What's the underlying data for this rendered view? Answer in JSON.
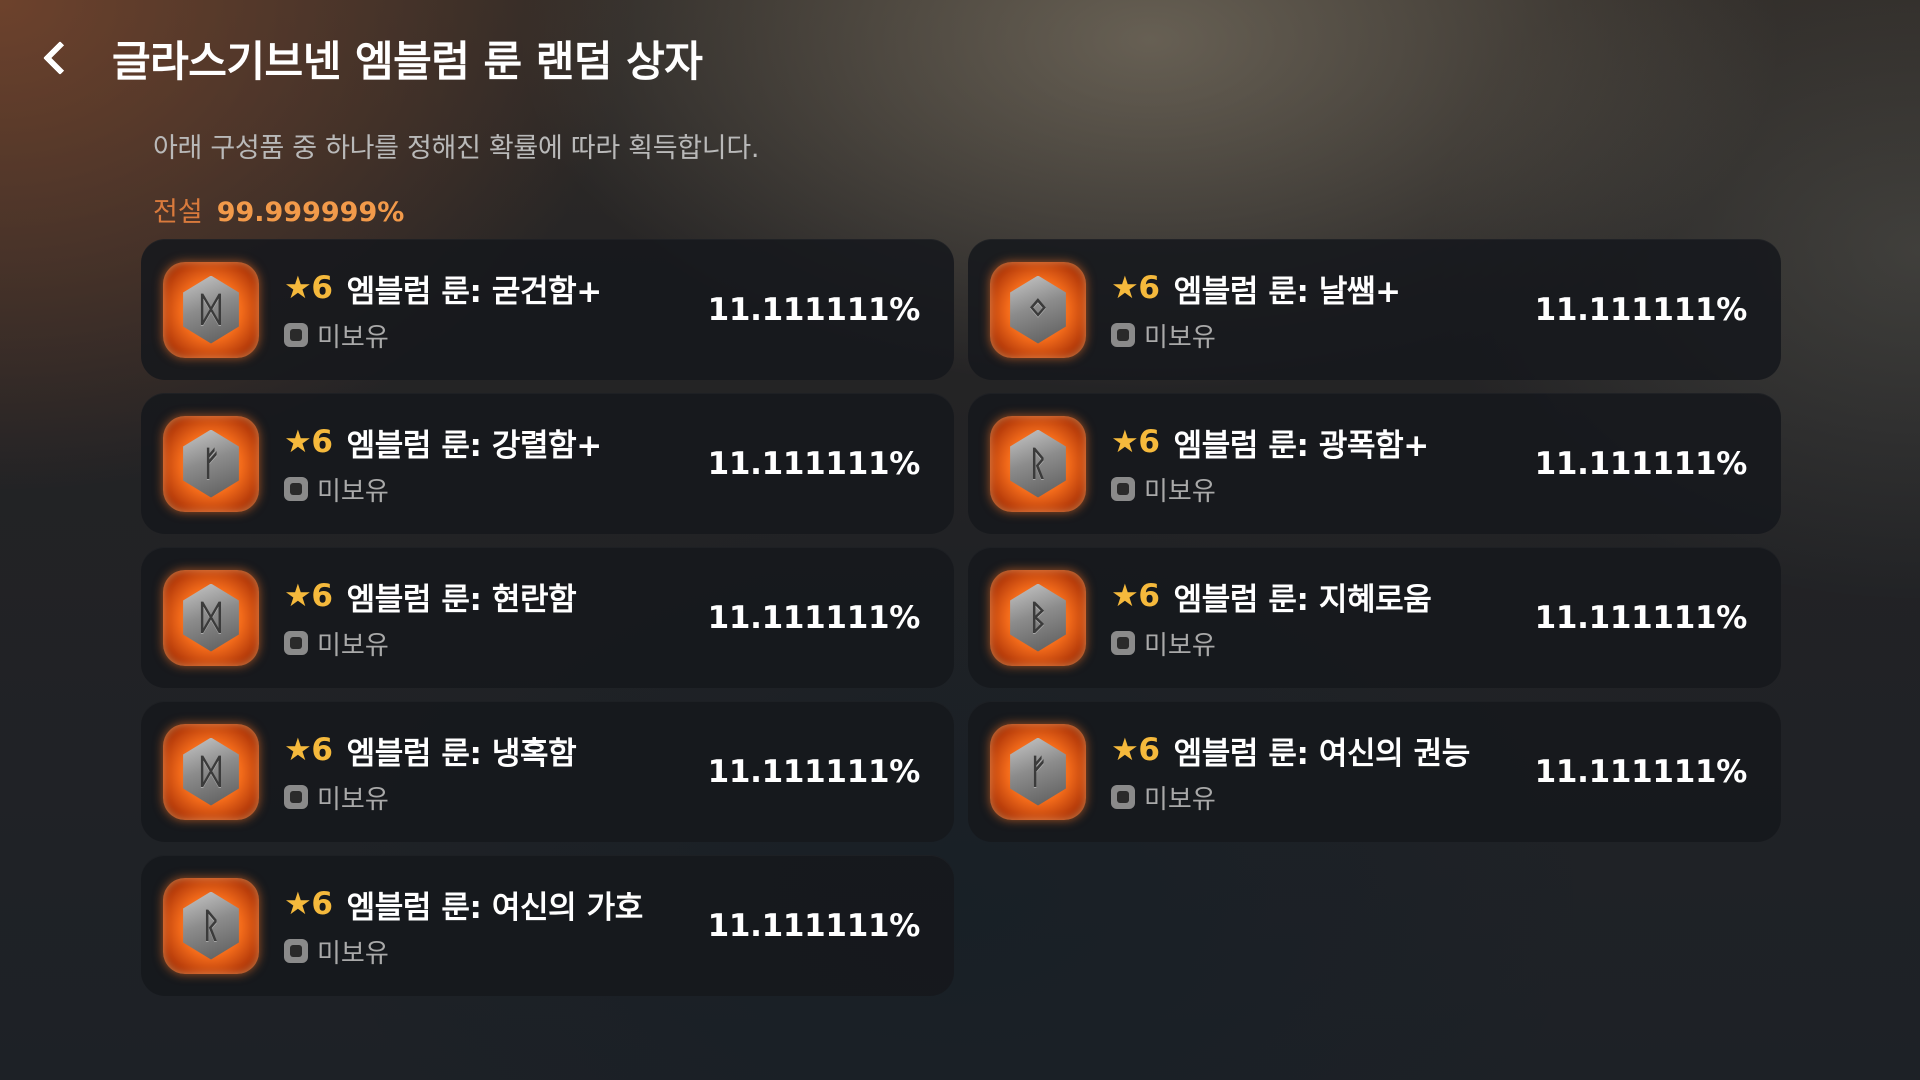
{
  "header": {
    "title": "글라스기브넨 엠블럼 룬 랜덤 상자",
    "back_icon": "chevron-left-icon"
  },
  "subtitle": "아래 구성품 중 하나를 정해진 확률에 따라 획득합니다.",
  "grade": {
    "name": "전설",
    "percent": "99.999999%"
  },
  "colors": {
    "accent_orange": "#f29a4a",
    "star_gold": "#f5b93c"
  },
  "items": [
    {
      "star": "★",
      "grade": "6",
      "name": "엠블럼 룬: 굳건함+",
      "owned": "미보유",
      "prob": "11.111111%",
      "rune_glyph": "ᛞ"
    },
    {
      "star": "★",
      "grade": "6",
      "name": "엠블럼 룬: 날쌤+",
      "owned": "미보유",
      "prob": "11.111111%",
      "rune_glyph": "ᛜ"
    },
    {
      "star": "★",
      "grade": "6",
      "name": "엠블럼 룬: 강렬함+",
      "owned": "미보유",
      "prob": "11.111111%",
      "rune_glyph": "ᚠ"
    },
    {
      "star": "★",
      "grade": "6",
      "name": "엠블럼 룬: 광폭함+",
      "owned": "미보유",
      "prob": "11.111111%",
      "rune_glyph": "ᚱ"
    },
    {
      "star": "★",
      "grade": "6",
      "name": "엠블럼 룬: 현란함",
      "owned": "미보유",
      "prob": "11.111111%",
      "rune_glyph": "ᛞ"
    },
    {
      "star": "★",
      "grade": "6",
      "name": "엠블럼 룬: 지혜로움",
      "owned": "미보유",
      "prob": "11.111111%",
      "rune_glyph": "ᛒ"
    },
    {
      "star": "★",
      "grade": "6",
      "name": "엠블럼 룬: 냉혹함",
      "owned": "미보유",
      "prob": "11.111111%",
      "rune_glyph": "ᛞ"
    },
    {
      "star": "★",
      "grade": "6",
      "name": "엠블럼 룬: 여신의 권능",
      "owned": "미보유",
      "prob": "11.111111%",
      "rune_glyph": "ᚠ"
    },
    {
      "star": "★",
      "grade": "6",
      "name": "엠블럼 룬: 여신의 가호",
      "owned": "미보유",
      "prob": "11.111111%",
      "rune_glyph": "ᚱ"
    }
  ]
}
